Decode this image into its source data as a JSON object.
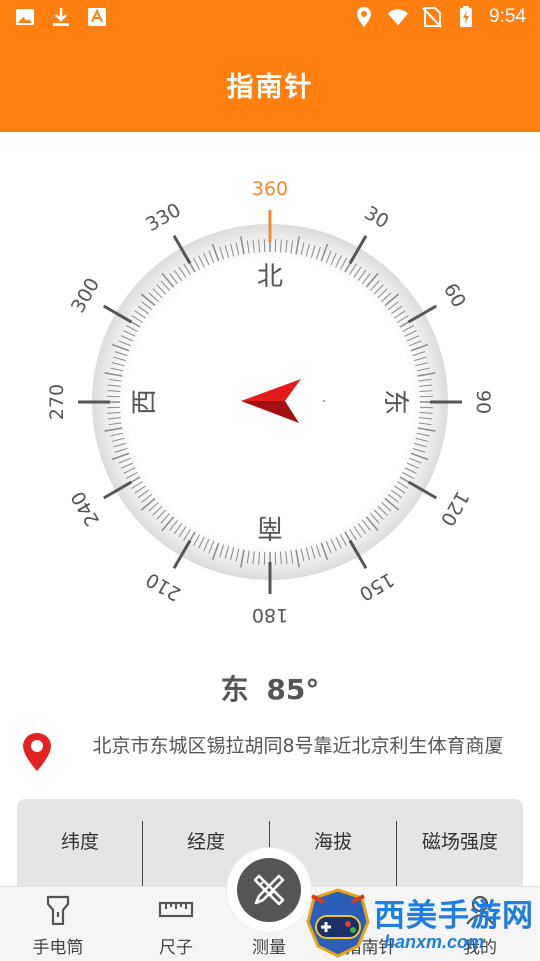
{
  "status_bar": {
    "time": "9:54",
    "left_icons": [
      "image-icon",
      "download-icon",
      "text-icon"
    ],
    "right_icons": [
      "location-icon",
      "wifi-icon",
      "no-sim-icon",
      "battery-charging-icon"
    ]
  },
  "app_bar": {
    "title": "指南针"
  },
  "compass": {
    "heading_degrees": 85,
    "degree_labels": [
      "360",
      "30",
      "60",
      "90",
      "120",
      "150",
      "180",
      "210",
      "240",
      "270",
      "300",
      "330"
    ],
    "cardinals": {
      "north": "北",
      "east": "东",
      "south": "南",
      "west": "西"
    },
    "accent_color": "#f7882f",
    "needle_color": "#c41414"
  },
  "heading": {
    "direction": "东",
    "degrees": "85°"
  },
  "location": {
    "address": "北京市东城区锡拉胡同8号靠近北京利生体育商厦"
  },
  "info_panel": {
    "items": [
      {
        "label": "纬度"
      },
      {
        "label": "经度"
      },
      {
        "label": "海拔"
      },
      {
        "label": "磁场强度"
      }
    ]
  },
  "bottom_nav": {
    "items": [
      {
        "label": "手电筒",
        "icon": "flashlight-icon"
      },
      {
        "label": "尺子",
        "icon": "ruler-icon"
      },
      {
        "label": "测量",
        "icon": "measure-icon"
      },
      {
        "label": "指南针",
        "icon": "compass-icon"
      },
      {
        "label": "我的",
        "icon": "profile-icon"
      }
    ]
  },
  "watermark": {
    "title": "西美手游网",
    "url": "hanxm.com"
  }
}
